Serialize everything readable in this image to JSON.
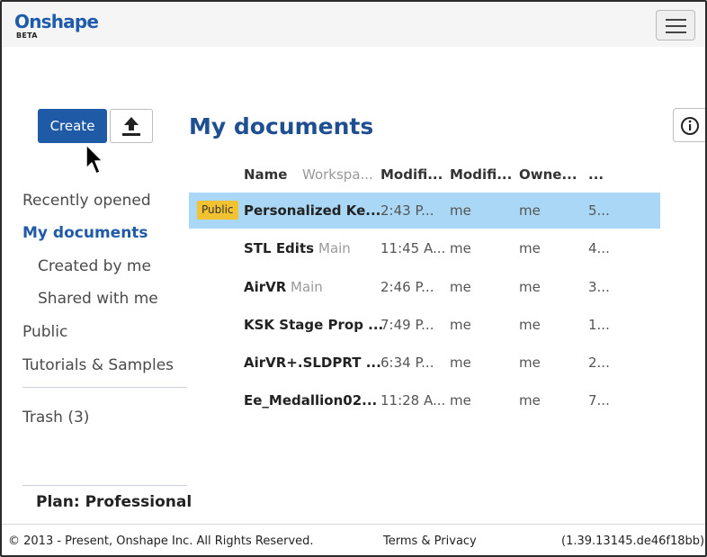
{
  "header": {
    "logo_name": "Onshape",
    "logo_tag": "BETA",
    "menu_icon": "hamburger-menu-icon"
  },
  "actions": {
    "create_label": "Create",
    "upload_icon": "upload-icon"
  },
  "nav": {
    "items": [
      {
        "label": "Recently opened"
      },
      {
        "label": "My documents"
      },
      {
        "label": "Created by me"
      },
      {
        "label": "Shared with me"
      },
      {
        "label": "Public"
      },
      {
        "label": "Tutorials & Samples"
      }
    ],
    "trash_label": "Trash",
    "trash_count": "(3)",
    "plan_label": "Plan: Professional"
  },
  "main": {
    "title": "My documents",
    "info_icon": "info-icon",
    "columns": [
      "Name",
      "Workspa...",
      "Modifi...",
      "Modifi...",
      "Owne...",
      "..."
    ],
    "rows": [
      {
        "badge": "Public",
        "name": "Personalized Ke...",
        "workspace": "",
        "modified": "2:43 P...",
        "modified_by": "me",
        "owner": "me",
        "size": "5..."
      },
      {
        "badge": "",
        "name": "STL Edits",
        "workspace": "Main",
        "modified": "11:45 A...",
        "modified_by": "me",
        "owner": "me",
        "size": "4..."
      },
      {
        "badge": "",
        "name": "AirVR",
        "workspace": "Main",
        "modified": "2:46 P...",
        "modified_by": "me",
        "owner": "me",
        "size": "3..."
      },
      {
        "badge": "",
        "name": "KSK Stage Prop ...",
        "workspace": "",
        "modified": "7:49 P...",
        "modified_by": "me",
        "owner": "me",
        "size": "1..."
      },
      {
        "badge": "",
        "name": "AirVR+.SLDPRT ...",
        "workspace": "",
        "modified": "6:34 P...",
        "modified_by": "me",
        "owner": "me",
        "size": "2..."
      },
      {
        "badge": "",
        "name": "Ee_Medallion02...",
        "workspace": "",
        "modified": "11:28 A...",
        "modified_by": "me",
        "owner": "me",
        "size": "7..."
      }
    ]
  },
  "footer": {
    "copyright": "© 2013 - Present, Onshape Inc. All Rights Reserved.",
    "terms": "Terms & Privacy",
    "version": "(1.39.13145.de46f18bb)"
  },
  "colors": {
    "brand": "#1f5aa6",
    "selected_row": "#a9d7f5",
    "public_badge": "#f2c233"
  }
}
